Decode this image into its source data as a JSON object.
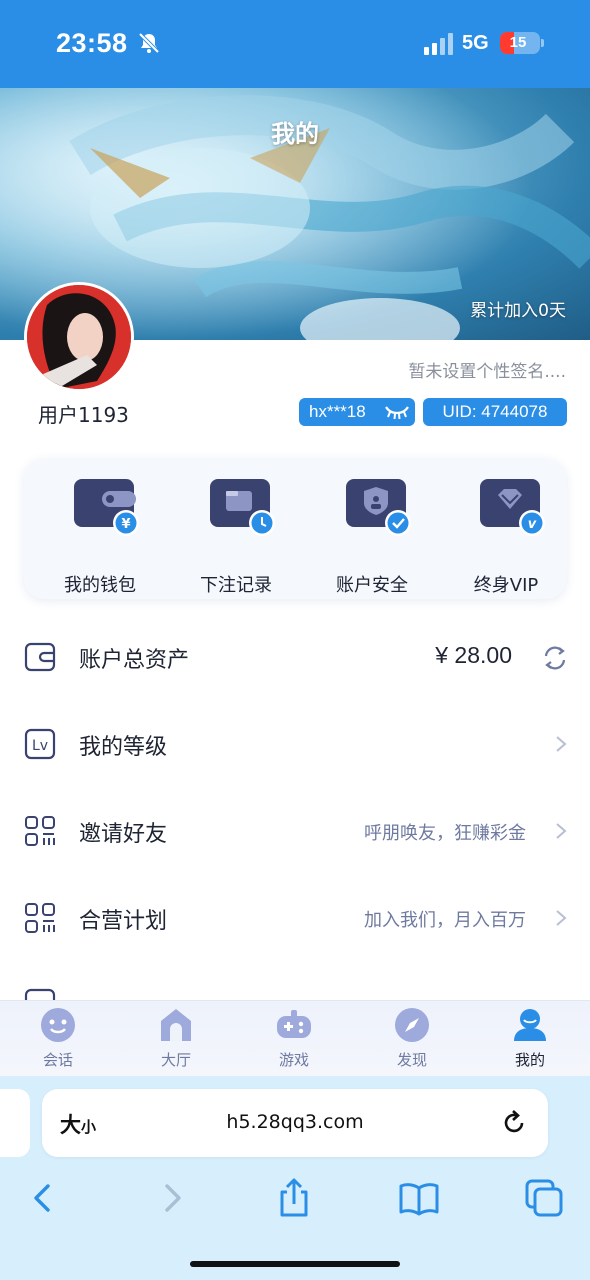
{
  "status_bar": {
    "time": "23:58",
    "network": "5G",
    "battery": "15"
  },
  "banner": {
    "title": "我的",
    "joined_text": "累计加入0天"
  },
  "profile": {
    "username": "用户1193",
    "signature": "暂未设置个性签名....",
    "account_badge": "hx***18",
    "uid_badge": "UID: 4744078"
  },
  "quick_actions": [
    {
      "label": "我的钱包",
      "icon": "wallet-icon"
    },
    {
      "label": "下注记录",
      "icon": "bet-record-icon"
    },
    {
      "label": "账户安全",
      "icon": "security-icon"
    },
    {
      "label": "终身VIP",
      "icon": "vip-icon"
    }
  ],
  "menu": {
    "assets": {
      "label": "账户总资产",
      "amount": "¥ 28.00"
    },
    "level": {
      "label": "我的等级"
    },
    "invite": {
      "label": "邀请好友",
      "hint": "呼朋唤友，狂赚彩金"
    },
    "partner": {
      "label": "合营计划",
      "hint": "加入我们，月入百万"
    }
  },
  "tabs": [
    {
      "label": "会话",
      "icon": "chat-icon"
    },
    {
      "label": "大厅",
      "icon": "hall-icon"
    },
    {
      "label": "游戏",
      "icon": "gamepad-icon"
    },
    {
      "label": "发现",
      "icon": "compass-icon"
    },
    {
      "label": "我的",
      "icon": "user-icon",
      "active": true
    }
  ],
  "browser": {
    "text_size_label": "大",
    "text_size_small": "小",
    "url": "h5.28qq3.com"
  },
  "colors": {
    "primary": "#2b8ee6",
    "icon_dark": "#3a4270",
    "text_muted": "#6f7aa0"
  }
}
